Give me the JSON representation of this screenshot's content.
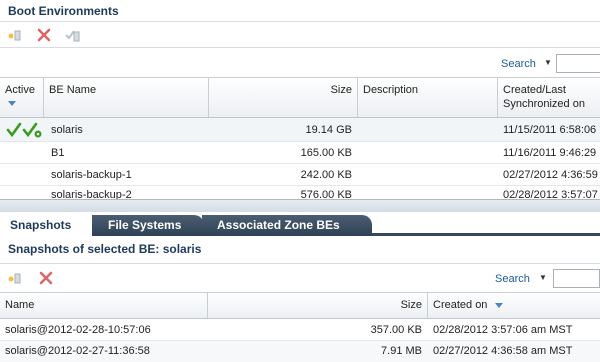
{
  "boot_env": {
    "title": "Boot Environments",
    "search_label": "Search",
    "columns": {
      "active": "Active",
      "be_name": "BE Name",
      "size": "Size",
      "description": "Description",
      "created_line1": "Created/Last",
      "created_line2": "Synchronized on"
    },
    "rows": [
      {
        "name": "solaris",
        "size": "19.14 GB",
        "description": "",
        "created": "11/15/2011 6:58:06"
      },
      {
        "name": "B1",
        "size": "165.00 KB",
        "description": "",
        "created": "11/16/2011 9:46:29"
      },
      {
        "name": "solaris-backup-1",
        "size": "242.00 KB",
        "description": "",
        "created": "02/27/2012 4:36:59"
      },
      {
        "name": "solaris-backup-2",
        "size": "576.00 KB",
        "description": "",
        "created": "02/28/2012 3:57:07"
      }
    ]
  },
  "tabs": [
    {
      "label": "Snapshots"
    },
    {
      "label": "File Systems"
    },
    {
      "label": "Associated Zone BEs"
    }
  ],
  "snapshots": {
    "title": "Snapshots of selected BE: solaris",
    "search_label": "Search",
    "columns": {
      "name": "Name",
      "size": "Size",
      "created": "Created on"
    },
    "rows": [
      {
        "name": "solaris@2012-02-28-10:57:06",
        "size": "357.00 KB",
        "created": "02/28/2012 3:57:06 am MST"
      },
      {
        "name": "solaris@2012-02-27-11:36:58",
        "size": "7.91 MB",
        "created": "02/27/2012 4:36:58 am MST"
      }
    ]
  },
  "colors": {
    "title": "#1e3a5c",
    "link": "#1c5a9c",
    "check": "#3a9a1e",
    "delete": "#e06565",
    "tab_dark": "#35495e"
  }
}
